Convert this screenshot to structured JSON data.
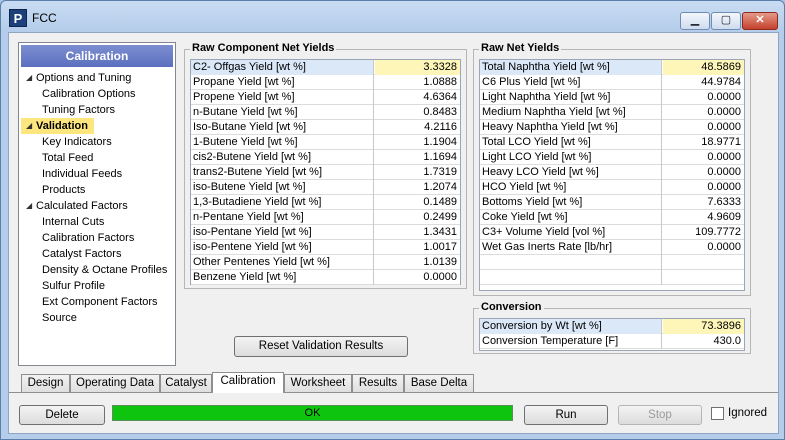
{
  "window": {
    "title": "FCC",
    "app_icon": "P"
  },
  "sidebar": {
    "header": "Calibration",
    "items": [
      {
        "label": "Options and Tuning",
        "level": 0,
        "expanded": true
      },
      {
        "label": "Calibration Options",
        "level": 1
      },
      {
        "label": "Tuning Factors",
        "level": 1
      },
      {
        "label": "Validation",
        "level": 0,
        "expanded": true,
        "selected": true
      },
      {
        "label": "Key Indicators",
        "level": 1
      },
      {
        "label": "Total Feed",
        "level": 1
      },
      {
        "label": "Individual Feeds",
        "level": 1
      },
      {
        "label": "Products",
        "level": 1
      },
      {
        "label": "Calculated Factors",
        "level": 0,
        "expanded": true
      },
      {
        "label": "Internal Cuts",
        "level": 1
      },
      {
        "label": "Calibration Factors",
        "level": 1
      },
      {
        "label": "Catalyst Factors",
        "level": 1
      },
      {
        "label": "Density & Octane Profiles",
        "level": 1
      },
      {
        "label": "Sulfur Profile",
        "level": 1
      },
      {
        "label": "Ext Component Factors",
        "level": 1
      },
      {
        "label": "Source",
        "level": 1
      }
    ]
  },
  "raw_component": {
    "title": "Raw Component Net Yields",
    "rows": [
      {
        "label": "C2- Offgas Yield [wt %]",
        "value": "3.3328"
      },
      {
        "label": "Propane Yield [wt %]",
        "value": "1.0888"
      },
      {
        "label": "Propene Yield [wt %]",
        "value": "4.6364"
      },
      {
        "label": "n-Butane Yield [wt %]",
        "value": "0.8483"
      },
      {
        "label": "Iso-Butane Yield [wt %]",
        "value": "4.2116"
      },
      {
        "label": "1-Butene Yield [wt %]",
        "value": "1.1904"
      },
      {
        "label": "cis2-Butene Yield [wt %]",
        "value": "1.1694"
      },
      {
        "label": "trans2-Butene Yield [wt %]",
        "value": "1.7319"
      },
      {
        "label": "iso-Butene Yield [wt %]",
        "value": "1.2074"
      },
      {
        "label": "1,3-Butadiene Yield [wt %]",
        "value": "0.1489"
      },
      {
        "label": "n-Pentane Yield [wt %]",
        "value": "0.2499"
      },
      {
        "label": "iso-Pentane Yield [wt %]",
        "value": "1.3431"
      },
      {
        "label": "iso-Pentene Yield [wt %]",
        "value": "1.0017"
      },
      {
        "label": "Other Pentenes Yield [wt %]",
        "value": "1.0139"
      },
      {
        "label": "Benzene Yield [wt %]",
        "value": "0.0000"
      }
    ]
  },
  "raw_net": {
    "title": "Raw Net Yields",
    "rows": [
      {
        "label": "Total Naphtha Yield [wt %]",
        "value": "48.5869"
      },
      {
        "label": "C6 Plus Yield [wt %]",
        "value": "44.9784"
      },
      {
        "label": "Light Naphtha Yield [wt %]",
        "value": "0.0000"
      },
      {
        "label": "Medium Naphtha Yield [wt %]",
        "value": "0.0000"
      },
      {
        "label": "Heavy Naphtha Yield [wt %]",
        "value": "0.0000"
      },
      {
        "label": "Total LCO Yield [wt %]",
        "value": "18.9771"
      },
      {
        "label": "Light LCO Yield [wt %]",
        "value": "0.0000"
      },
      {
        "label": "Heavy LCO Yield [wt %]",
        "value": "0.0000"
      },
      {
        "label": "HCO Yield [wt %]",
        "value": "0.0000"
      },
      {
        "label": "Bottoms Yield [wt %]",
        "value": "7.6333"
      },
      {
        "label": "Coke Yield [wt %]",
        "value": "4.9609"
      },
      {
        "label": "C3+ Volume Yield [vol %]",
        "value": "109.7772"
      },
      {
        "label": "Wet Gas Inerts Rate [lb/hr]",
        "value": "0.0000"
      }
    ]
  },
  "conversion": {
    "title": "Conversion",
    "rows": [
      {
        "label": "Conversion by Wt [wt %]",
        "value": "73.3896"
      },
      {
        "label": "Conversion Temperature [F]",
        "value": "430.0"
      }
    ]
  },
  "buttons": {
    "reset": "Reset Validation Results",
    "delete": "Delete",
    "run": "Run",
    "stop": "Stop"
  },
  "tabs": [
    "Design",
    "Operating Data",
    "Catalyst",
    "Calibration",
    "Worksheet",
    "Results",
    "Base Delta"
  ],
  "active_tab": "Calibration",
  "status": {
    "text": "OK",
    "color": "#0ec40e"
  },
  "ignored": {
    "label": "Ignored",
    "checked": false
  },
  "colors": {
    "selection": "#fde67d",
    "highlight_cell": "#fdf6b8",
    "sidebar_header": "#6a7ec7"
  }
}
